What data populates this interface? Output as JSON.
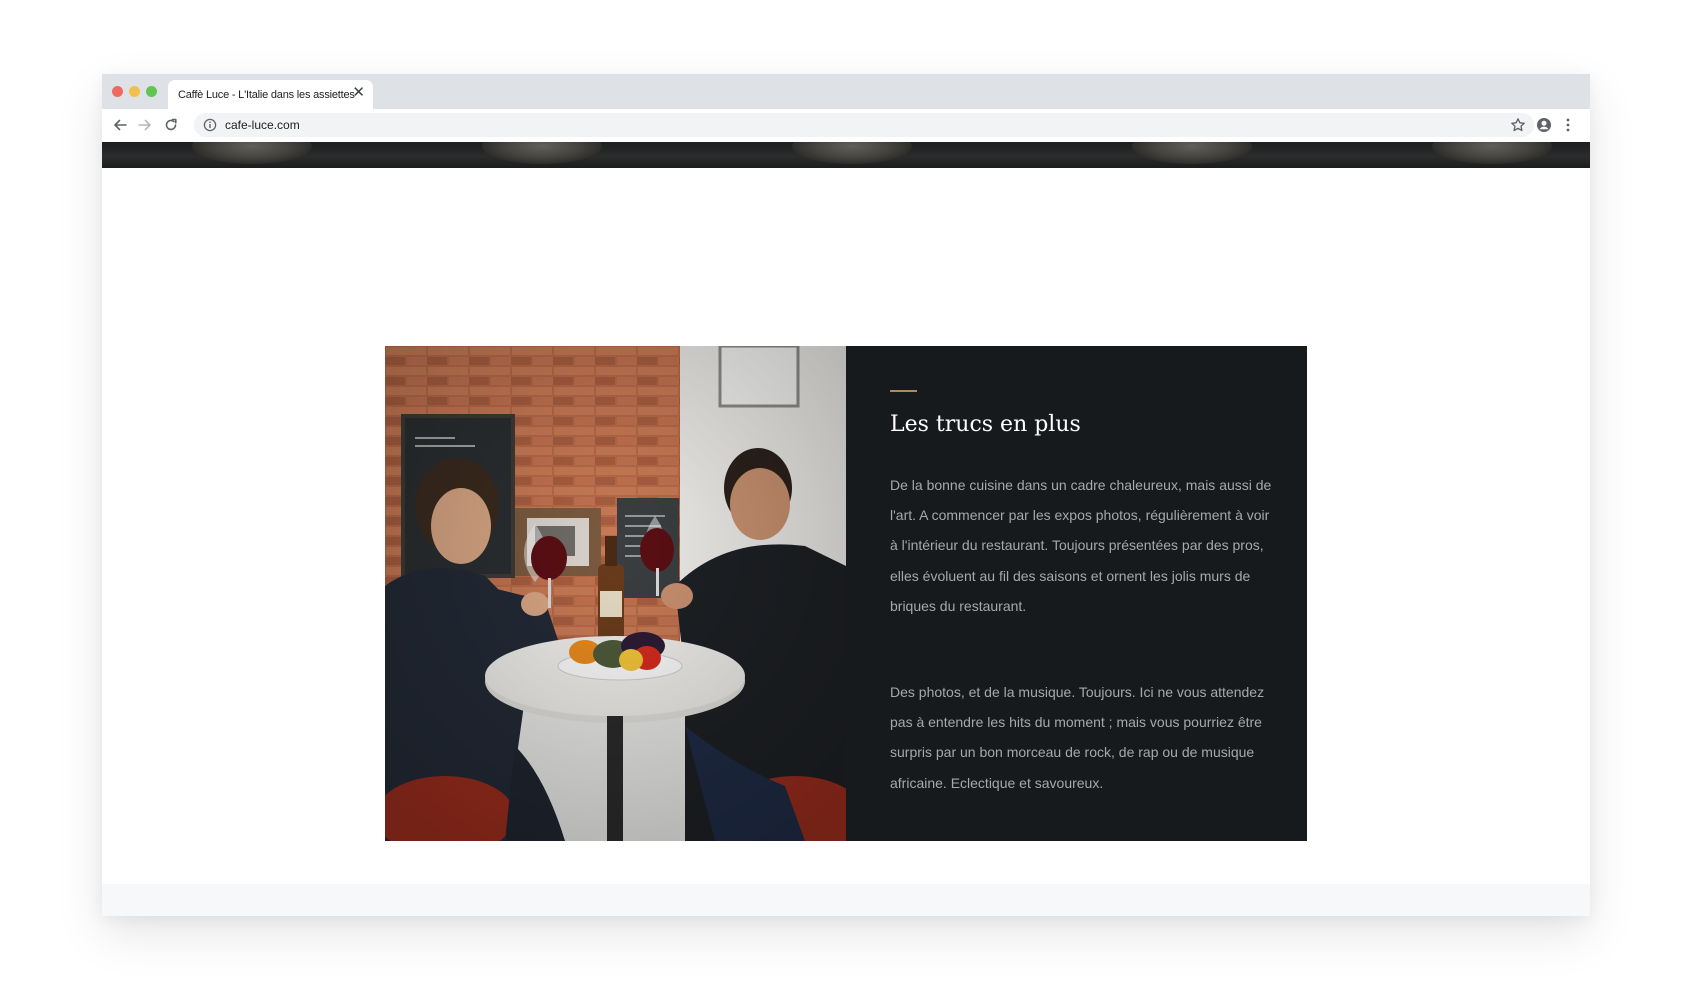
{
  "browser": {
    "tab_title": "Caffè Luce - L'Italie dans les assiettes",
    "tab_close": "✕",
    "url": "cafe-luce.com",
    "icons": [
      "back-arrow-icon",
      "forward-arrow-icon",
      "reload-icon",
      "info-icon",
      "star-icon",
      "profile-icon",
      "kebab-menu-icon"
    ]
  },
  "feature": {
    "photo_alt": "Deux hommes trinquant avec du vin rouge à une table",
    "title": "Les trucs en plus",
    "paragraphs": [
      "De la bonne cuisine dans un cadre chaleureux, mais aussi de l'art. A commencer par les expos photos, régulièrement à voir à l'intérieur du restaurant. Toujours présentées par des pros, elles évoluent au fil des saisons et ornent les jolis murs de briques du restaurant.",
      "Des photos, et de la musique. Toujours. Ici ne vous attendez pas à entendre les hits du moment ; mais vous pourriez être surpris par un bon morceau de rock, de rap ou de musique africaine. Eclectique et savoureux."
    ]
  },
  "colors": {
    "panel_bg": "#171a1d",
    "accent": "#b08a5a",
    "panel_text": "#a6a8ab",
    "title_text": "#ffffff",
    "tabbar_bg": "#dee1e6"
  }
}
